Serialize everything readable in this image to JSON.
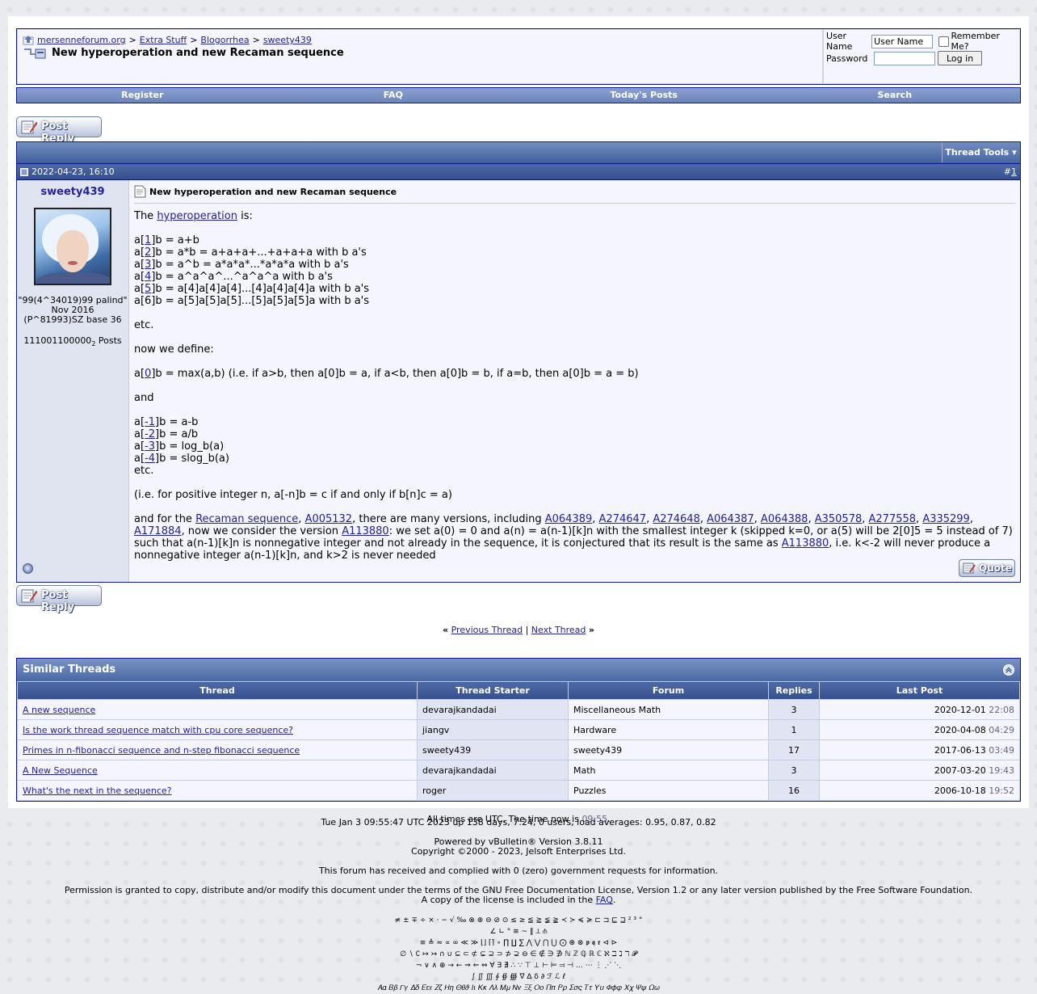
{
  "breadcrumb": {
    "items": [
      "mersenneforum.org",
      "Extra Stuff",
      "Blogorrhea",
      "sweety439"
    ],
    "sep": ">"
  },
  "thread_title": "New hyperoperation and new Recaman sequence",
  "login": {
    "username_label": "User Name",
    "username_value": "User Name",
    "remember_label": "Remember Me?",
    "password_label": "Password",
    "login_button": "Log in"
  },
  "menu": [
    "Register",
    "FAQ",
    "Today's Posts",
    "Search"
  ],
  "post_reply": "Post Reply",
  "thread_tools": "Thread Tools",
  "post": {
    "date": "2022-04-23, 16:10",
    "number_prefix": "#",
    "number": "1",
    "author": "sweety439",
    "user_title_1": "\"99(4^34019)99 palind\"",
    "user_title_2": "Nov 2016",
    "user_title_3": "(P^81993)SZ base 36",
    "posts_count": "111001100000",
    "posts_base": "2",
    "posts_label": "Posts",
    "title": "New hyperoperation and new Recaman sequence",
    "quote_button": "Quote"
  },
  "msg": {
    "l1a": "The ",
    "l1link": "hyperoperation",
    "l1b": " is:",
    "h1": "1",
    "h1t": "]b = a+b",
    "h2": "2",
    "h2t": "]b = a*b = a+a+a+...+a+a+a with b a's",
    "h3": "3",
    "h3t": "]b = a^b = a*a*a*...*a*a*a with b a's",
    "h4": "4",
    "h4t": "]b = a^a^a^...^a^a^a with b a's",
    "h5": "5",
    "h5t": "]b = a[4]a[4]a[4]...[4]a[4]a[4]a with b a's",
    "h6": "a[6]b = a[5]a[5]a[5]...[5]a[5]a[5]a with b a's",
    "etc": "etc.",
    "define": "now we define:",
    "z0": "0",
    "z0t": "]b = max(a,b) (i.e. if a>b, then a[0]b = a, if a<b, then a[0]b = b, if a=b, then a[0]b = a = b)",
    "and": "and",
    "n1": "-1",
    "n1t": "]b = a-b",
    "n2": "-2",
    "n2t": "]b = a/b",
    "n3": "-3",
    "n3t": "]b = log_b(a)",
    "n4": "-4",
    "n4t": "]b = slog_b(a)",
    "etc2": "etc.",
    "ie": "(i.e. for positive integer n, a[-n]b = c if and only if b[n]c = a)",
    "rec_pre": "and for the ",
    "rec_link": "Recaman sequence",
    "a005132": "A005132",
    "rec_mid": ", there are many versions, including ",
    "seqs": [
      "A064389",
      "A274647",
      "A274648",
      "A064387",
      "A064388",
      "A350578",
      "A277558",
      "A335299",
      "A171884"
    ],
    "rec_post": ", now we consider the version ",
    "a113880": "A113880",
    "rec_tail": ": we set a(0) = 0 and a(n) = a(n-1)[k]n with the smallest integer k (skipped k=0, or a(5) will be 2[0]5 = 5 instead of 7) such that a(n-1)[k]n is nonnegative integer and not already in the sequence, it is conjectured that its result is the same as ",
    "a113880b": "A113880",
    "rec_end": ", i.e. k<-2 will never produce a nonnegative integer a(n-1)[k]n, and k>2 is never needed"
  },
  "threadnav": {
    "left": "«",
    "prev": "Previous Thread",
    "sep": "|",
    "next": "Next Thread",
    "right": "»"
  },
  "similar": {
    "title": "Similar Threads",
    "headers": [
      "Thread",
      "Thread Starter",
      "Forum",
      "Replies",
      "Last Post"
    ],
    "rows": [
      {
        "thread": "A new sequence",
        "starter": "devarajkandadai",
        "forum": "Miscellaneous Math",
        "replies": "3",
        "date": "2020-12-01",
        "time": "22:08"
      },
      {
        "thread": "Is the work thread sequence match with cpu core sequence?",
        "starter": "jiangv",
        "forum": "Hardware",
        "replies": "1",
        "date": "2020-04-08",
        "time": "04:29"
      },
      {
        "thread": "Primes in n-fibonacci sequence and n-step fibonacci sequence",
        "starter": "sweety439",
        "forum": "sweety439",
        "replies": "17",
        "date": "2017-06-13",
        "time": "03:49"
      },
      {
        "thread": "A New Sequence",
        "starter": "devarajkandadai",
        "forum": "Math",
        "replies": "3",
        "date": "2007-03-20",
        "time": "19:43"
      },
      {
        "thread": "What's the next in the sequence?",
        "starter": "roger",
        "forum": "Puzzles",
        "replies": "16",
        "date": "2006-10-18",
        "time": "19:52"
      }
    ]
  },
  "alltimes": {
    "text": "All times are UTC. The time now is ",
    "time": "09:55",
    "end": "."
  },
  "footer": {
    "uptime": "Tue Jan 3 09:55:47 UTC 2023 up 138 days, 7:24, 0 users, load averages: 0.95, 0.87, 0.82",
    "powered": "Powered by vBulletin® Version 3.8.11",
    "copyright": "Copyright ©2000 - 2023, Jelsoft Enterprises Ltd.",
    "requests": "This forum has received and complied with 0 (zero) government requests for information.",
    "permission": "Permission is granted to copy, distribute and/or modify this document under the terms of the GNU Free Documentation License, Version 1.2 or any later version published by the Free Software Foundation.",
    "license_pre": "A copy of the license is included in the ",
    "license_link": "FAQ",
    "license_end": ".",
    "sym1": "≠ ± ∓ ÷ × · − √ ‰ ⊗ ⊕ ⊖ ⊘ ⊙ ≤ ≥ ≦ ≧ ≨ ≩ ≺ ≻ ≼ ≽ ⊏ ⊐ ⊑ ⊒ ² ³ °",
    "sym2": "∠ ∟ ° ≅ ~ ‖ ⟂ ⫛",
    "sym3": "≡ ≜ ≈ ∝ ∞ ≪ ≫ ⌊⌋ ⌈⌉ ∘ ∏ ∐ ∑ ⋀ ⋁ ⋂ ⋃ ⨀ ⊕ ⊗ 𝖕 𝖖 𝖗 ⊲ ⊳",
    "sym4": "∅ ∖ ∁ ↦ ↣ ∩ ∪ ⊆ ⊂ ⊄ ⊊ ⊇ ⊃ ⊅ ⊋ ⊖ ∈ ∉ ∋ ∌ ℕ ℤ ℚ ℝ ℂ ℵ ℶ ℷ ℸ 𝓟",
    "sym5": "¬ ∨ ∧ ⊕ → ← ⇒ ⇐ ⇔ ∀ ∃ ∄ ∴ ∵ ⊤ ⊥ ⊢ ⊨ ⫤ ⊣ … ⋯ ⋮ ⋰ ⋱",
    "sym6": "∫ ∬ ∭ ∮ ∯ ∰ ∇ ∆ δ ∂ ℱ ℒ ℓ",
    "sym7": "𝛢𝛼 𝛣𝛽 𝛤𝛾 𝛥𝛿 𝛦𝜀𝜖 𝛧𝜁 𝛨𝜂 𝛩𝜃𝜗 𝛪𝜄 𝛫𝜅 𝛬𝜆 𝛭𝜇 𝛮𝜈 𝛯𝜉 𝛰𝜊 𝛱𝜋 𝛲𝜌 𝛴𝜎𝜍 𝛵𝜏 𝛶𝜐 𝛷𝜙𝜑 𝛸𝜒 𝛹𝜓 𝛺𝜔"
  },
  "colors": {
    "link": "#22229c",
    "header_blue": "#344f8c",
    "alt1": "#f5f5ff",
    "alt2": "#e1e4f2"
  }
}
